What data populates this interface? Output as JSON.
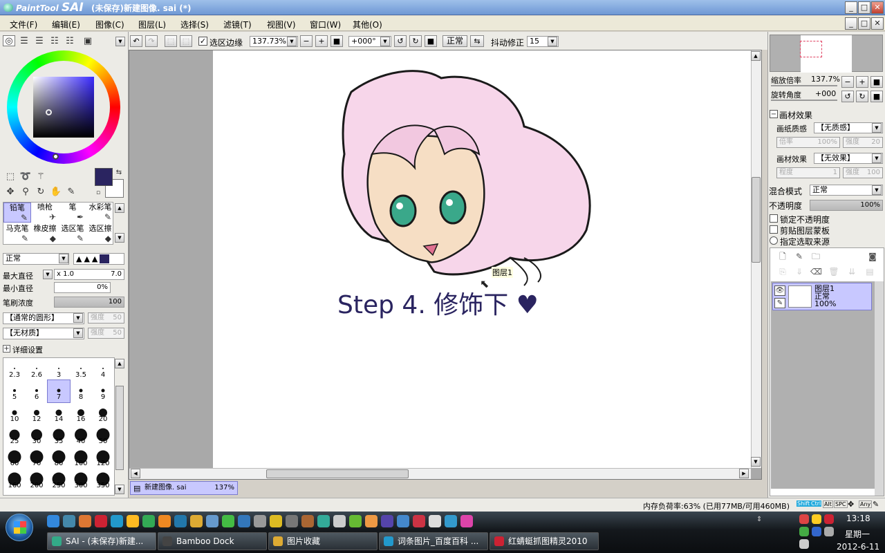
{
  "window": {
    "app_logo_text": "PaintTool",
    "app_logo_bold": "SAI",
    "title": "(未保存)新建图像. sai (*)"
  },
  "menu": [
    "文件(F)",
    "编辑(E)",
    "图像(C)",
    "图层(L)",
    "选择(S)",
    "滤镜(T)",
    "视图(V)",
    "窗口(W)",
    "其他(O)"
  ],
  "tools": {
    "rows": [
      [
        "铅笔",
        "喷枪",
        "笔",
        "水彩笔"
      ],
      [
        "马克笔",
        "橡皮擦",
        "选区笔",
        "选区擦"
      ]
    ],
    "blend_mode": "正常",
    "max_size_label": "最大直径",
    "max_size_mult": "x 1.0",
    "max_size_value": "7.0",
    "min_size_label": "最小直径",
    "min_size_value": "0%",
    "density_label": "笔刷浓度",
    "density_value": "100",
    "shape": "【通常的圆形】",
    "texture": "【无材质】",
    "strength_label": "强度",
    "strength_value": "50",
    "advanced_label": "详细设置"
  },
  "brush_sizes": [
    "2.3",
    "2.6",
    "3",
    "3.5",
    "4",
    "5",
    "6",
    "7",
    "8",
    "9",
    "10",
    "12",
    "14",
    "16",
    "20",
    "25",
    "30",
    "35",
    "40",
    "50",
    "60",
    "70",
    "80",
    "100",
    "120",
    "160",
    "200",
    "250",
    "300",
    "350"
  ],
  "brush_selected": "7",
  "toolbar": {
    "selection_edge_label": "选区边缘",
    "zoom": "137.73%",
    "rotation": "+000°",
    "blend": "正常",
    "stabilizer_label": "抖动修正",
    "stabilizer_value": "15"
  },
  "canvas": {
    "caption": "Step 4. 修饰下 ♥",
    "cursor_tooltip": "图层1"
  },
  "doc_tab": {
    "name": "新建图像. sai",
    "zoom": "137%"
  },
  "navigator": {
    "zoom_label": "缩放倍率",
    "zoom_value": "137.7%",
    "rotate_label": "旋转角度",
    "rotate_value": "+000"
  },
  "texture_panel": {
    "header": "画材效果",
    "paper_label": "画纸质感",
    "paper_value": "【无质感】",
    "scale_label": "倍率",
    "scale_value": "100%",
    "strength_label": "强度",
    "strength_value": "20",
    "effect_label": "画材效果",
    "effect_value": "【无效果】",
    "degree_label": "程度",
    "degree_value": "1",
    "strength2_label": "强度",
    "strength2_value": "100"
  },
  "layer_props": {
    "blend_label": "混合模式",
    "blend_value": "正常",
    "opacity_label": "不透明度",
    "opacity_value": "100%",
    "lock_opacity": "锁定不透明度",
    "clip_mask": "剪贴图层蒙板",
    "selection_source": "指定选取来源"
  },
  "layer": {
    "name": "图层1",
    "mode": "正常",
    "opacity": "100%"
  },
  "status": {
    "memory": "内存负荷率:63% (已用77MB/可用460MB)",
    "keys": [
      "Shift",
      "Ctrl",
      "Alt",
      "SPC",
      "Any"
    ]
  },
  "taskbar": {
    "tasks": [
      "SAI - (未保存)新建...",
      "Bamboo Dock",
      "图片收藏",
      "词条图片_百度百科 ...",
      "红蜻蜓抓图精灵2010"
    ],
    "time": "13:18",
    "weekday": "星期一",
    "date": "2012-6-11"
  },
  "colors": {
    "primary": "#2a2460",
    "accent": "#c8c8ff",
    "titlebar": "#7aa3dc"
  }
}
